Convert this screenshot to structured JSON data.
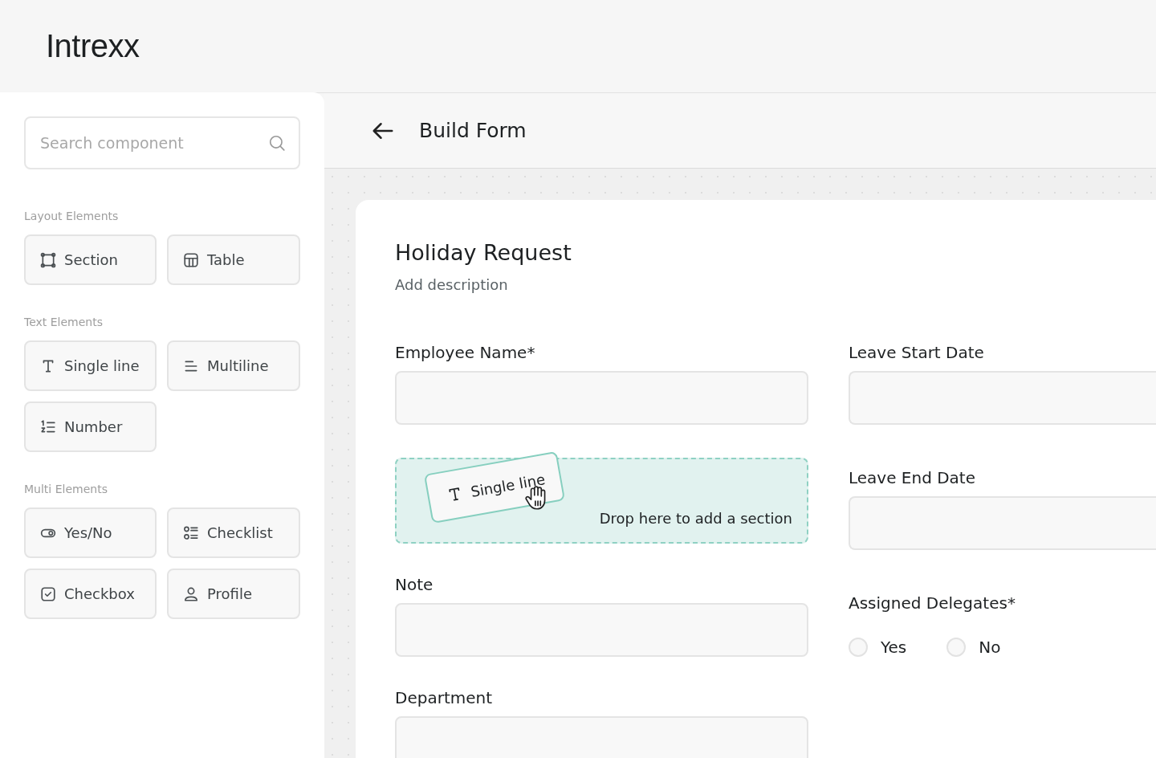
{
  "logo": {
    "text": "Intrexx"
  },
  "sidebar": {
    "search": {
      "placeholder": "Search component"
    },
    "groups": [
      {
        "title": "Layout Elements",
        "items": [
          {
            "label": "Section",
            "kind": "section"
          },
          {
            "label": "Table",
            "kind": "table"
          }
        ]
      },
      {
        "title": "Text Elements",
        "items": [
          {
            "label": "Single line",
            "kind": "text"
          },
          {
            "label": "Multiline",
            "kind": "multiline"
          },
          {
            "label": "Number",
            "kind": "number"
          }
        ]
      },
      {
        "title": "Multi Elements",
        "items": [
          {
            "label": "Yes/No",
            "kind": "toggle"
          },
          {
            "label": "Checklist",
            "kind": "checklist"
          },
          {
            "label": "Checkbox",
            "kind": "checkbox"
          },
          {
            "label": "Profile",
            "kind": "profile"
          }
        ]
      }
    ]
  },
  "header": {
    "title": "Build Form"
  },
  "form": {
    "title": "Holiday Request",
    "description": "Add description",
    "columns": [
      [
        {
          "kind": "input",
          "label": "Employee Name*"
        },
        {
          "kind": "dropzone",
          "label": "Drop here to add a section",
          "dragged": {
            "label": "Single line",
            "kind": "text"
          }
        },
        {
          "kind": "input",
          "label": "Note"
        },
        {
          "kind": "input",
          "label": "Department"
        }
      ],
      [
        {
          "kind": "input",
          "label": "Leave Start Date"
        },
        {
          "kind": "input",
          "label": "Leave End Date"
        },
        {
          "kind": "radio",
          "label": "Assigned Delegates*",
          "options": [
            {
              "label": "Yes",
              "selected": false
            },
            {
              "label": "No",
              "selected": false
            }
          ]
        }
      ]
    ]
  }
}
